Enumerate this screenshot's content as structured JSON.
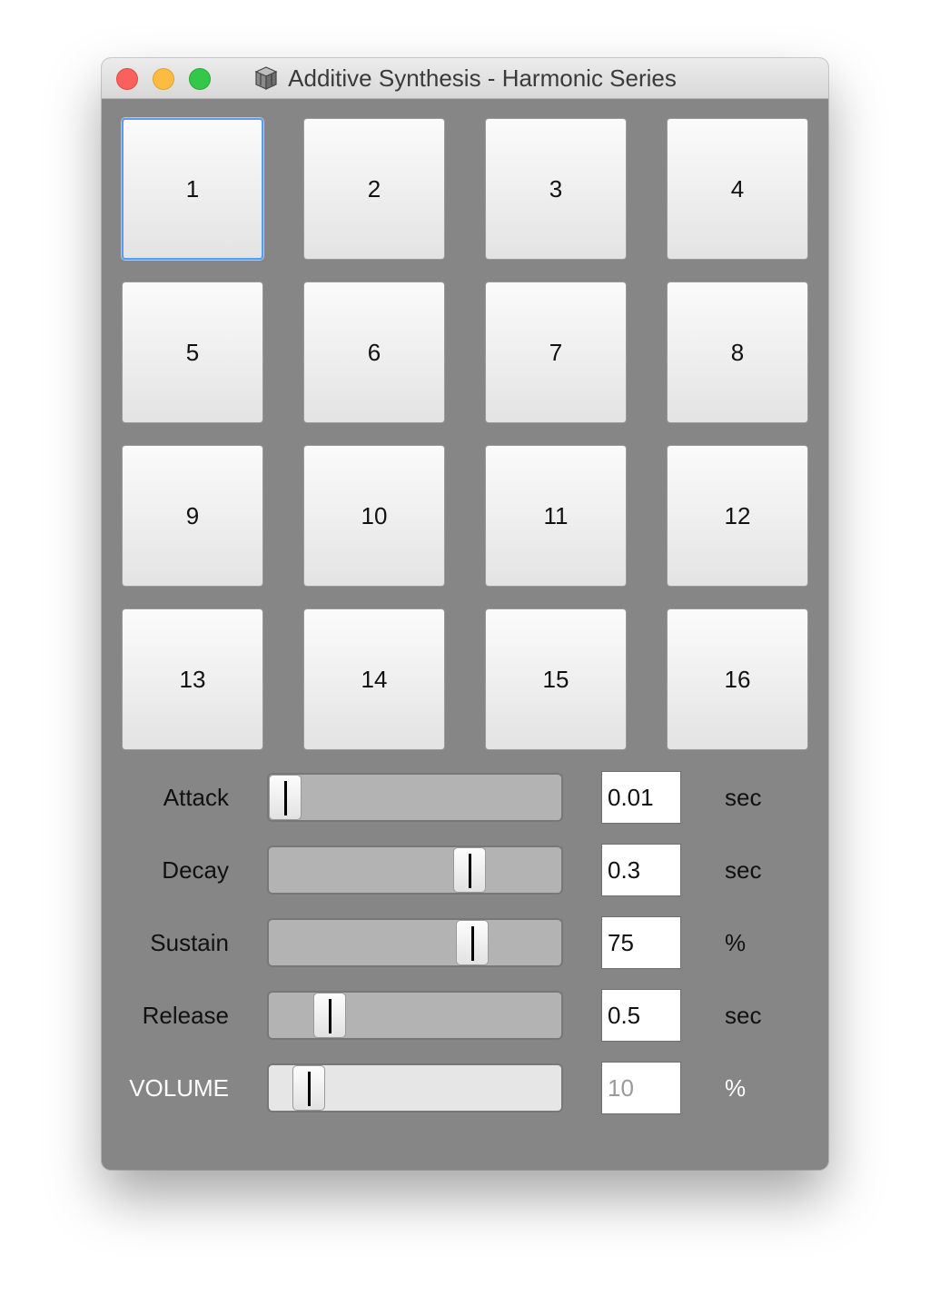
{
  "window": {
    "title": "Additive Synthesis - Harmonic Series"
  },
  "pads": [
    "1",
    "2",
    "3",
    "4",
    "5",
    "6",
    "7",
    "8",
    "9",
    "10",
    "11",
    "12",
    "13",
    "14",
    "15",
    "16"
  ],
  "params": [
    {
      "label": "Attack",
      "value": "0.01",
      "unit": "sec",
      "slider_fraction": 0.0
    },
    {
      "label": "Decay",
      "value": "0.3",
      "unit": "sec",
      "slider_fraction": 0.71
    },
    {
      "label": "Sustain",
      "value": "75",
      "unit": "%",
      "slider_fraction": 0.72
    },
    {
      "label": "Release",
      "value": "0.5",
      "unit": "sec",
      "slider_fraction": 0.17
    },
    {
      "label": "VOLUME",
      "value": "10",
      "unit": "%",
      "slider_fraction": 0.09
    }
  ],
  "colors": {
    "window_bg": "#868686",
    "focus_ring": "#5d9ce6",
    "close": "#fc605c",
    "minimize": "#fdbc40",
    "maximize": "#34c84a"
  }
}
